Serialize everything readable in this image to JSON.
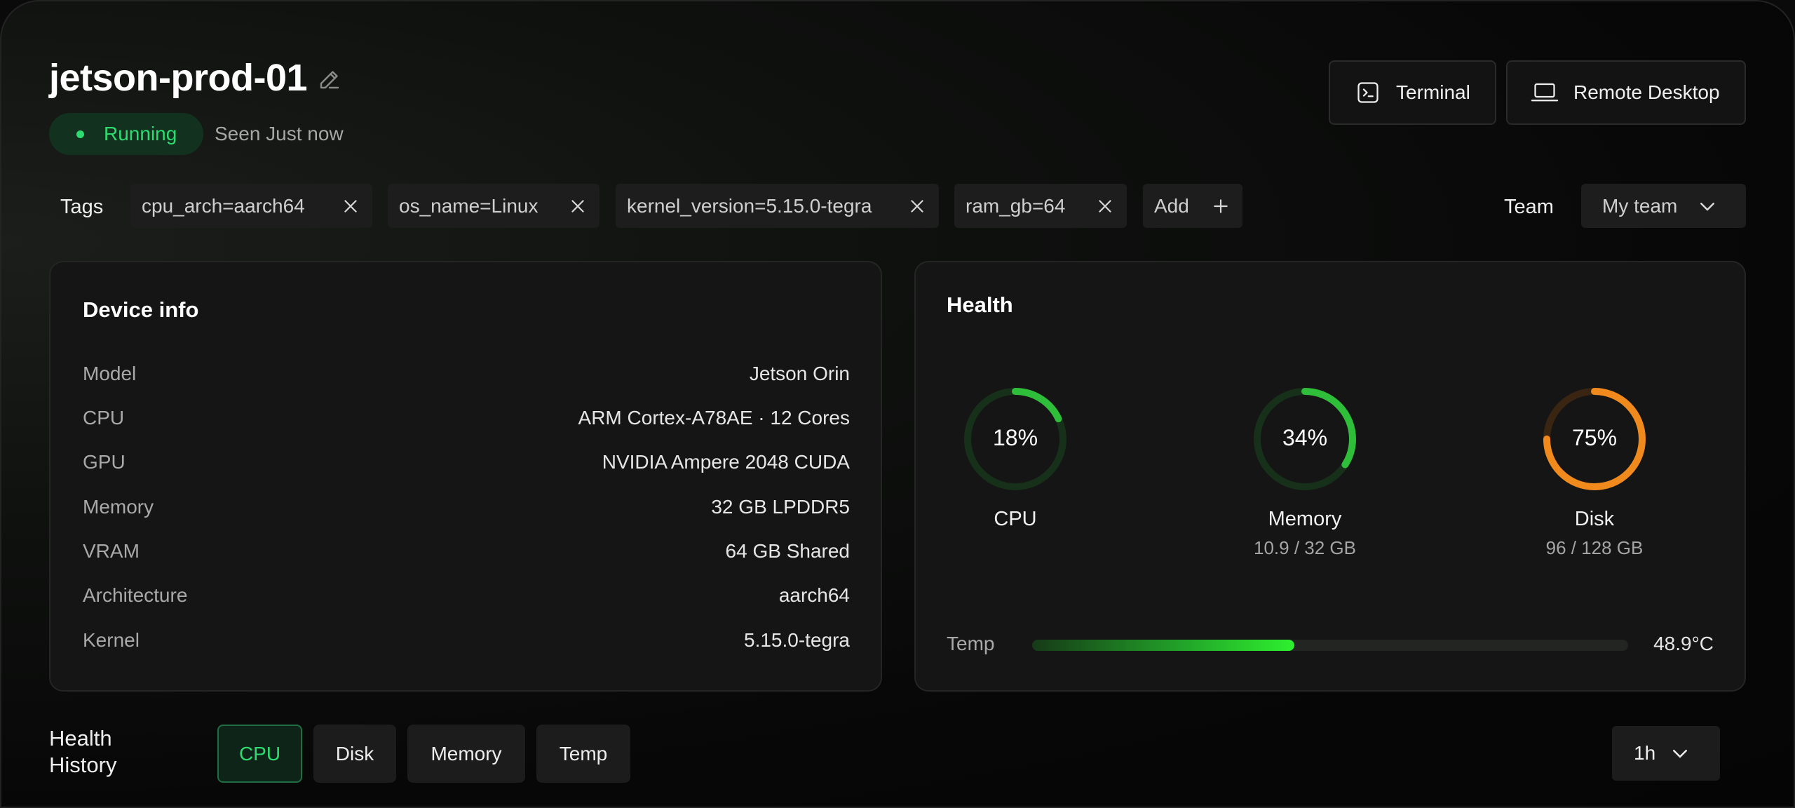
{
  "device": {
    "name": "jetson-prod-01",
    "status": "Running",
    "last_seen": "Seen Just now"
  },
  "actions": {
    "terminal_label": "Terminal",
    "remote_label": "Remote Desktop"
  },
  "tags": {
    "label": "Tags",
    "items": [
      {
        "text": "cpu_arch=aarch64"
      },
      {
        "text": "os_name=Linux"
      },
      {
        "text": "kernel_version=5.15.0-tegra"
      },
      {
        "text": "ram_gb=64"
      }
    ],
    "add_label": "Add"
  },
  "team": {
    "label": "Team",
    "selected": "My team"
  },
  "device_info": {
    "title": "Device info",
    "rows": [
      {
        "label": "Model",
        "value": "Jetson Orin"
      },
      {
        "label": "CPU",
        "value": "ARM Cortex-A78AE · 12 Cores"
      },
      {
        "label": "GPU",
        "value": "NVIDIA Ampere 2048 CUDA"
      },
      {
        "label": "Memory",
        "value": "32 GB LPDDR5"
      },
      {
        "label": "VRAM",
        "value": "64 GB Shared"
      },
      {
        "label": "Architecture",
        "value": "aarch64"
      },
      {
        "label": "Kernel",
        "value": "5.15.0-tegra"
      }
    ]
  },
  "health": {
    "title": "Health",
    "gauges": [
      {
        "name": "CPU",
        "percent": 18,
        "percent_label": "18%",
        "sub": "",
        "color": "#2fbe3a",
        "track": "#17301a"
      },
      {
        "name": "Memory",
        "percent": 34,
        "percent_label": "34%",
        "sub": "10.9 / 32 GB",
        "color": "#2fbe3a",
        "track": "#17301a"
      },
      {
        "name": "Disk",
        "percent": 75,
        "percent_label": "75%",
        "sub": "96 / 128 GB",
        "color": "#f08a1c",
        "track": "#3a2412"
      }
    ],
    "temp": {
      "label": "Temp",
      "value": "48.9°C",
      "fill_fraction": 0.44
    }
  },
  "history": {
    "label": "Health History",
    "tabs": [
      {
        "label": "CPU",
        "active": true
      },
      {
        "label": "Disk",
        "active": false
      },
      {
        "label": "Memory",
        "active": false
      },
      {
        "label": "Temp",
        "active": false
      }
    ],
    "range": "1h"
  },
  "colors": {
    "accent_green": "#2ddc70",
    "disk_orange": "#f08a1c"
  }
}
